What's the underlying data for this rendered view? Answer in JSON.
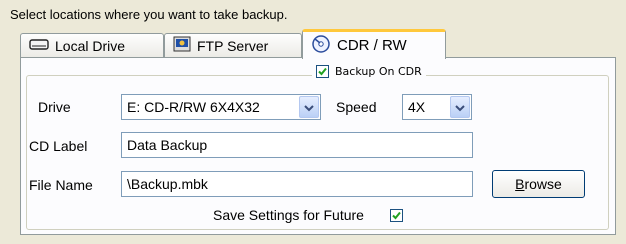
{
  "instruction": "Select locations where you want to take backup.",
  "tabs": [
    {
      "label": "Local Drive",
      "icon": "drive-icon"
    },
    {
      "label": "FTP Server",
      "icon": "ftp-server-icon"
    },
    {
      "label": "CDR / RW",
      "icon": "cd-burner-icon"
    }
  ],
  "active_tab": "CDR / RW",
  "backup_on_cdr": {
    "label": "Backup On CDR",
    "checked": true
  },
  "drive": {
    "label": "Drive",
    "value": "E: CD-R/RW 6X4X32"
  },
  "speed": {
    "label": "Speed",
    "value": "4X"
  },
  "cd_label": {
    "label": "CD Label",
    "value": "Data Backup"
  },
  "file_name": {
    "label": "File Name",
    "value": "\\Backup.mbk"
  },
  "browse": {
    "label_first": "B",
    "label_rest": "rowse"
  },
  "save_settings": {
    "label": "Save Settings for Future",
    "checked": true
  },
  "colors": {
    "active_tab_accent": "#ffc83c",
    "window_bg": "#ece9d8",
    "panel_bg": "#fcfcfe"
  }
}
